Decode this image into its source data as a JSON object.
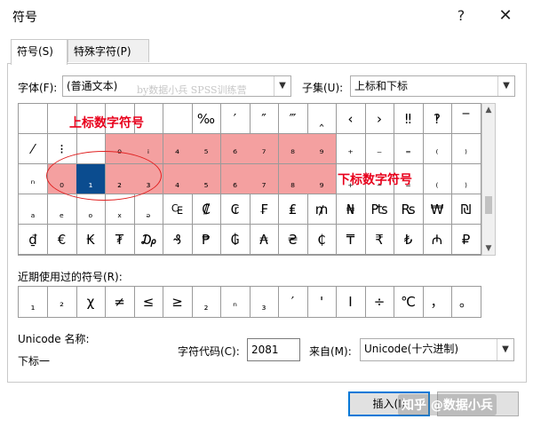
{
  "window": {
    "title": "符号",
    "help_icon": "?",
    "close_icon": "✕"
  },
  "tabs": [
    {
      "label": "符号(S)"
    },
    {
      "label": "特殊字符(P)"
    }
  ],
  "font": {
    "label": "字体(F):",
    "value": "(普通文本)"
  },
  "subset": {
    "label": "子集(U):",
    "value": "上标和下标"
  },
  "watermark_top": "by数据小兵 SPSS训练营",
  "annotations": {
    "superscript": "上标数字符号",
    "subscript": "下标数字符号"
  },
  "grid": {
    "rows": [
      [
        "",
        "",
        "",
        "",
        "",
        "",
        "‰",
        "′",
        "″",
        "‴",
        "‸",
        "‹",
        "›",
        "‼",
        "‽",
        "‾"
      ],
      [
        "⁄",
        "⁝",
        "",
        "⁰",
        "ⁱ",
        "⁴",
        "⁵",
        "⁶",
        "⁷",
        "⁸",
        "⁹",
        "⁺",
        "⁻",
        "⁼",
        "⁽",
        "⁾"
      ],
      [
        "ⁿ",
        "₀",
        "₁",
        "₂",
        "₃",
        "₄",
        "₅",
        "₆",
        "₇",
        "₈",
        "₉",
        "₊",
        "₋",
        "₌",
        "₍",
        "₎"
      ],
      [
        "ₐ",
        "ₑ",
        "ₒ",
        "ₓ",
        "ₔ",
        "₠",
        "₡",
        "₢",
        "₣",
        "₤",
        "₥",
        "₦",
        "₧",
        "₨",
        "₩",
        "₪"
      ],
      [
        "₫",
        "€",
        "₭",
        "₮",
        "₯",
        "₰",
        "₱",
        "₲",
        "₳",
        "₴",
        "₵",
        "₸",
        "₹",
        "₺",
        "₼",
        "₽"
      ]
    ]
  },
  "recent": {
    "label": "近期使用过的符号(R):",
    "items": [
      "₁",
      "²",
      "χ",
      "≠",
      "≤",
      "≥",
      "₂",
      "ⁿ",
      "₃",
      "′",
      "'",
      "Ⅰ",
      "÷",
      "℃",
      "，",
      "。"
    ]
  },
  "unicode": {
    "label": "Unicode 名称:",
    "name": "下标一"
  },
  "charcode": {
    "label": "字符代码(C):",
    "value": "2081"
  },
  "from": {
    "label": "来自(M):",
    "value": "Unicode(十六进制)"
  },
  "buttons": {
    "insert": "插入(I)"
  },
  "watermark_bottom": "知乎 @数据小兵",
  "colors": {
    "selected": "#0b4c8f",
    "highlight": "#f4a0a0",
    "annotation": "#e8001c"
  }
}
